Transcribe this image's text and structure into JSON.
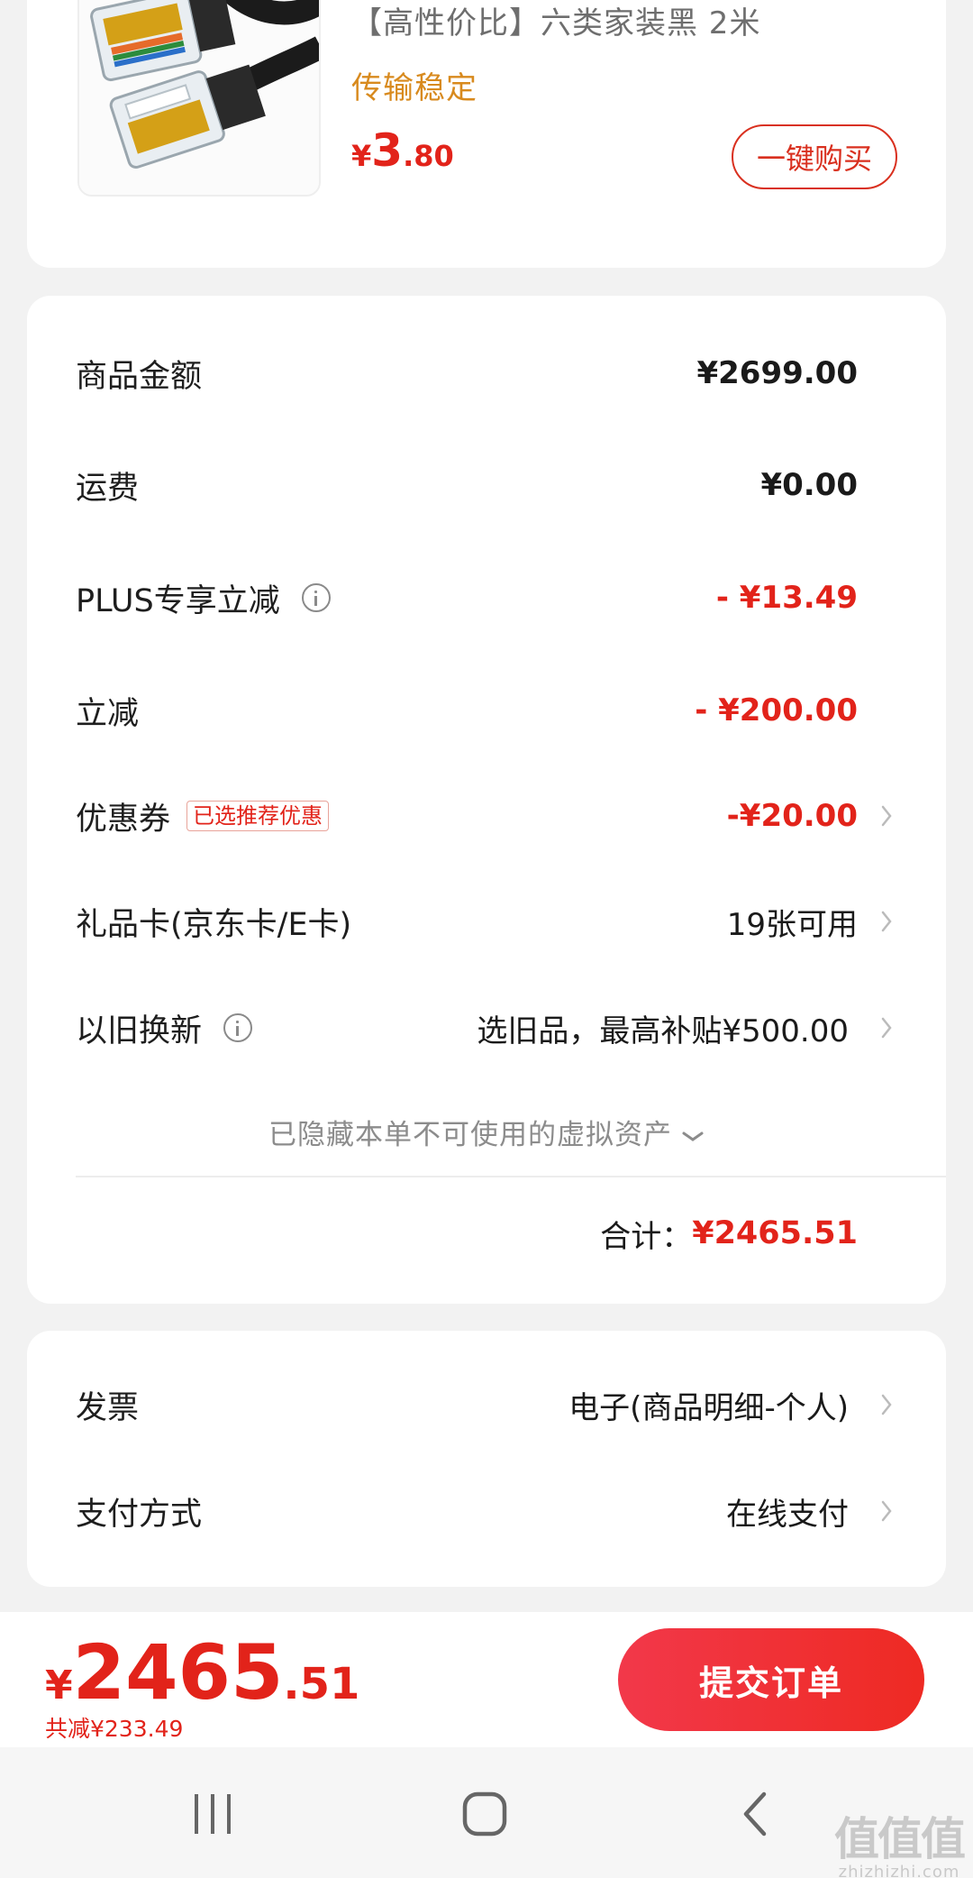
{
  "product": {
    "title": "【高性价比】六类家装黑   2米",
    "tag": "传输稳定",
    "price_currency": "¥",
    "price_int": "3",
    "price_dec": ".80",
    "buy_label": "一键购买"
  },
  "summary": {
    "rows": [
      {
        "label": "商品金额",
        "value": "¥2699.00"
      },
      {
        "label": "运费",
        "value": "¥0.00"
      },
      {
        "label": "PLUS专享立减",
        "value": "- ¥13.49"
      },
      {
        "label": "立减",
        "value": "- ¥200.00"
      },
      {
        "label": "优惠券",
        "badge": "已选推荐优惠",
        "value": "-¥20.00"
      },
      {
        "label": "礼品卡(京东卡/E卡)",
        "value": "19张可用"
      },
      {
        "label": "以旧换新",
        "value": "选旧品，最高补贴¥500.00"
      }
    ],
    "hidden_assets": "已隐藏本单不可使用的虚拟资产",
    "total_label": "合计：",
    "total_value": "¥2465.51"
  },
  "extra": {
    "invoice_label": "发票",
    "invoice_value": "电子(商品明细-个人)",
    "payment_label": "支付方式",
    "payment_value": "在线支付"
  },
  "submit_bar": {
    "currency": "¥",
    "price_int": "2465",
    "price_dec": ".51",
    "saved": "共减¥233.49",
    "submit_label": "提交订单"
  },
  "watermark": {
    "logo": "值值值",
    "domain": "zhizhizhi.com"
  },
  "colors": {
    "accent": "#e2231a",
    "tag": "#d88a1e",
    "submit_gradient": [
      "#f2384a",
      "#ee2a23"
    ]
  }
}
